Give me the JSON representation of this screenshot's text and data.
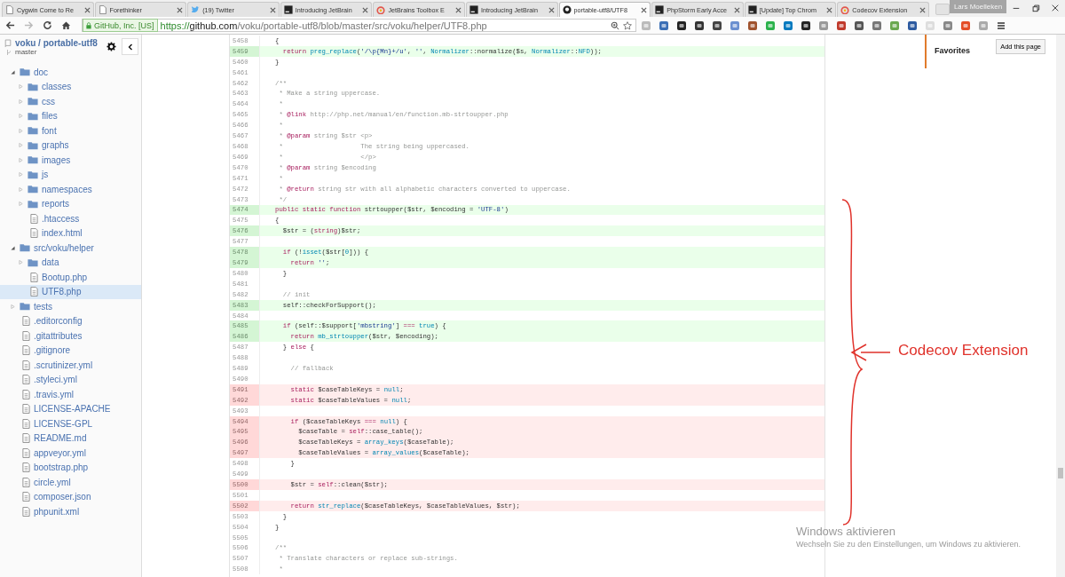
{
  "browser": {
    "tabs": [
      {
        "title": "Cygwin Come to Re",
        "selected": false
      },
      {
        "title": "Forethinker",
        "selected": false
      },
      {
        "title": "(19) Twitter",
        "selected": false
      },
      {
        "title": "Introducing JetBrain",
        "selected": false
      },
      {
        "title": "JetBrains Toolbox E",
        "selected": false
      },
      {
        "title": "Introducing JetBrain",
        "selected": false
      },
      {
        "title": "portable-utf8/UTF8",
        "selected": true
      },
      {
        "title": "PhpStorm Early Acce",
        "selected": false
      },
      {
        "title": "[Update] Top Chrom",
        "selected": false
      },
      {
        "title": "Codecov Extension",
        "selected": false
      }
    ],
    "user": "Lars Moelleken",
    "security_badge": "GitHub, Inc. [US]",
    "url": {
      "scheme": "https://",
      "host": "github.com",
      "path": "/voku/portable-utf8/blob/master/src/voku/helper/UTF8.php"
    }
  },
  "sidebar": {
    "repo": "voku / portable-utf8",
    "branch": "master",
    "tree": [
      {
        "label": "doc",
        "kind": "folder",
        "expanded": true,
        "selected": false,
        "children": [
          {
            "label": "classes",
            "kind": "folder",
            "expanded": false,
            "selected": false
          },
          {
            "label": "css",
            "kind": "folder",
            "expanded": false,
            "selected": false
          },
          {
            "label": "files",
            "kind": "folder",
            "expanded": false,
            "selected": false
          },
          {
            "label": "font",
            "kind": "folder",
            "expanded": false,
            "selected": false
          },
          {
            "label": "graphs",
            "kind": "folder",
            "expanded": false,
            "selected": false
          },
          {
            "label": "images",
            "kind": "folder",
            "expanded": false,
            "selected": false
          },
          {
            "label": "js",
            "kind": "folder",
            "expanded": false,
            "selected": false
          },
          {
            "label": "namespaces",
            "kind": "folder",
            "expanded": false,
            "selected": false
          },
          {
            "label": "reports",
            "kind": "folder",
            "expanded": false,
            "selected": false
          },
          {
            "label": ".htaccess",
            "kind": "file",
            "selected": false
          },
          {
            "label": "index.html",
            "kind": "file",
            "selected": false
          }
        ]
      },
      {
        "label": "src/voku/helper",
        "kind": "folder",
        "expanded": true,
        "selected": false,
        "children": [
          {
            "label": "data",
            "kind": "folder",
            "expanded": false,
            "selected": false
          },
          {
            "label": "Bootup.php",
            "kind": "file",
            "selected": false
          },
          {
            "label": "UTF8.php",
            "kind": "file",
            "selected": true
          }
        ]
      },
      {
        "label": "tests",
        "kind": "folder",
        "expanded": false,
        "selected": false
      },
      {
        "label": ".editorconfig",
        "kind": "file",
        "selected": false
      },
      {
        "label": ".gitattributes",
        "kind": "file",
        "selected": false
      },
      {
        "label": ".gitignore",
        "kind": "file",
        "selected": false
      },
      {
        "label": ".scrutinizer.yml",
        "kind": "file",
        "selected": false
      },
      {
        "label": ".styleci.yml",
        "kind": "file",
        "selected": false
      },
      {
        "label": ".travis.yml",
        "kind": "file",
        "selected": false
      },
      {
        "label": "LICENSE-APACHE",
        "kind": "file",
        "selected": false
      },
      {
        "label": "LICENSE-GPL",
        "kind": "file",
        "selected": false
      },
      {
        "label": "README.md",
        "kind": "file",
        "selected": false
      },
      {
        "label": "appveyor.yml",
        "kind": "file",
        "selected": false
      },
      {
        "label": "bootstrap.php",
        "kind": "file",
        "selected": false
      },
      {
        "label": "circle.yml",
        "kind": "file",
        "selected": false
      },
      {
        "label": "composer.json",
        "kind": "file",
        "selected": false
      },
      {
        "label": "phpunit.xml",
        "kind": "file",
        "selected": false
      }
    ]
  },
  "code": {
    "lines": [
      {
        "n": "5458",
        "kind": "plain",
        "tokens": [
          {
            "t": "{"
          }
        ]
      },
      {
        "n": "5459",
        "kind": "covered",
        "tokens": [
          {
            "kind": "kw",
            "t": "  return "
          },
          {
            "kind": "fn",
            "t": "preg_replace"
          },
          {
            "t": "("
          },
          {
            "kind": "str",
            "t": "'/\\p{Mn}+/u'"
          },
          {
            "t": ", "
          },
          {
            "kind": "str",
            "t": "''"
          },
          {
            "t": ", "
          },
          {
            "kind": "fn",
            "t": "Normalizer"
          },
          {
            "t": "::normalize($s, "
          },
          {
            "kind": "fn",
            "t": "Normalizer"
          },
          {
            "t": "::"
          },
          {
            "kind": "fn",
            "t": "NFD"
          },
          {
            "t": "));"
          }
        ]
      },
      {
        "n": "5460",
        "kind": "plain",
        "tokens": [
          {
            "t": "}"
          }
        ]
      },
      {
        "n": "5461",
        "kind": "plain"
      },
      {
        "n": "5462",
        "kind": "plain",
        "tokens": [
          {
            "kind": "cm",
            "t": "/**"
          }
        ]
      },
      {
        "n": "5463",
        "kind": "plain",
        "tokens": [
          {
            "kind": "cm",
            "t": " * Make a string uppercase."
          }
        ]
      },
      {
        "n": "5464",
        "kind": "plain",
        "tokens": [
          {
            "kind": "cm",
            "t": " *"
          }
        ]
      },
      {
        "n": "5465",
        "kind": "plain",
        "tokens": [
          {
            "kind": "cm",
            "t": " * "
          },
          {
            "kind": "kw",
            "t": "@link"
          },
          {
            "kind": "cm",
            "t": " http://php.net/manual/en/function.mb-strtoupper.php"
          }
        ]
      },
      {
        "n": "5466",
        "kind": "plain",
        "tokens": [
          {
            "kind": "cm",
            "t": " *"
          }
        ]
      },
      {
        "n": "5467",
        "kind": "plain",
        "tokens": [
          {
            "kind": "cm",
            "t": " * "
          },
          {
            "kind": "kw",
            "t": "@param"
          },
          {
            "kind": "cm",
            "t": " string $str <p>"
          }
        ]
      },
      {
        "n": "5468",
        "kind": "plain",
        "tokens": [
          {
            "kind": "cm",
            "t": " *                    The string being uppercased."
          }
        ]
      },
      {
        "n": "5469",
        "kind": "plain",
        "tokens": [
          {
            "kind": "cm",
            "t": " *                    </p>"
          }
        ]
      },
      {
        "n": "5470",
        "kind": "plain",
        "tokens": [
          {
            "kind": "cm",
            "t": " * "
          },
          {
            "kind": "kw",
            "t": "@param"
          },
          {
            "kind": "cm",
            "t": " string $encoding"
          }
        ]
      },
      {
        "n": "5471",
        "kind": "plain",
        "tokens": [
          {
            "kind": "cm",
            "t": " *"
          }
        ]
      },
      {
        "n": "5472",
        "kind": "plain",
        "tokens": [
          {
            "kind": "cm",
            "t": " * "
          },
          {
            "kind": "kw",
            "t": "@return"
          },
          {
            "kind": "cm",
            "t": " string str with all alphabetic characters converted to uppercase."
          }
        ]
      },
      {
        "n": "5473",
        "kind": "plain",
        "tokens": [
          {
            "kind": "cm",
            "t": " */"
          }
        ]
      },
      {
        "n": "5474",
        "kind": "covered",
        "tokens": [
          {
            "kind": "kw",
            "t": "public static function"
          },
          {
            "t": " strtoupper($str, $encoding = "
          },
          {
            "kind": "str",
            "t": "'UTF-8'"
          },
          {
            "t": ")"
          }
        ]
      },
      {
        "n": "5475",
        "kind": "plain",
        "tokens": [
          {
            "t": "{"
          }
        ]
      },
      {
        "n": "5476",
        "kind": "covered",
        "tokens": [
          {
            "t": "  $str = ("
          },
          {
            "kind": "kw",
            "t": "string"
          },
          {
            "t": ")$str;"
          }
        ]
      },
      {
        "n": "5477",
        "kind": "plain"
      },
      {
        "n": "5478",
        "kind": "covered",
        "tokens": [
          {
            "kind": "kw",
            "t": "  if"
          },
          {
            "t": " (!"
          },
          {
            "kind": "fn",
            "t": "isset"
          },
          {
            "t": "($str["
          },
          {
            "kind": "fn",
            "t": "0"
          },
          {
            "t": "])) {"
          }
        ]
      },
      {
        "n": "5479",
        "kind": "covered",
        "tokens": [
          {
            "kind": "kw",
            "t": "    return "
          },
          {
            "kind": "str",
            "t": "''"
          },
          {
            "t": ";"
          }
        ]
      },
      {
        "n": "5480",
        "kind": "plain",
        "tokens": [
          {
            "t": "  }"
          }
        ]
      },
      {
        "n": "5481",
        "kind": "plain"
      },
      {
        "n": "5482",
        "kind": "plain",
        "tokens": [
          {
            "kind": "cm",
            "t": "  // init"
          }
        ]
      },
      {
        "n": "5483",
        "kind": "covered",
        "tokens": [
          {
            "t": "  self::checkForSupport();"
          }
        ]
      },
      {
        "n": "5484",
        "kind": "plain"
      },
      {
        "n": "5485",
        "kind": "covered",
        "tokens": [
          {
            "kind": "kw",
            "t": "  if"
          },
          {
            "t": " (self::$support["
          },
          {
            "kind": "str",
            "t": "'mbstring'"
          },
          {
            "t": "] "
          },
          {
            "kind": "kw",
            "t": "=== "
          },
          {
            "kind": "fn",
            "t": "true"
          },
          {
            "t": ") {"
          }
        ]
      },
      {
        "n": "5486",
        "kind": "covered",
        "tokens": [
          {
            "kind": "kw",
            "t": "    return "
          },
          {
            "kind": "fn",
            "t": "mb_strtoupper"
          },
          {
            "t": "($str, $encoding);"
          }
        ]
      },
      {
        "n": "5487",
        "kind": "plain",
        "tokens": [
          {
            "t": "  } "
          },
          {
            "kind": "kw",
            "t": "else"
          },
          {
            "t": " {"
          }
        ]
      },
      {
        "n": "5488",
        "kind": "plain"
      },
      {
        "n": "5489",
        "kind": "plain",
        "tokens": [
          {
            "kind": "cm",
            "t": "    // fallback"
          }
        ]
      },
      {
        "n": "5490",
        "kind": "plain"
      },
      {
        "n": "5491",
        "kind": "missed",
        "tokens": [
          {
            "kind": "kw",
            "t": "    static"
          },
          {
            "t": " $caseTableKeys = "
          },
          {
            "kind": "fn",
            "t": "null"
          },
          {
            "t": ";"
          }
        ]
      },
      {
        "n": "5492",
        "kind": "missed",
        "tokens": [
          {
            "kind": "kw",
            "t": "    static"
          },
          {
            "t": " $caseTableValues = "
          },
          {
            "kind": "fn",
            "t": "null"
          },
          {
            "t": ";"
          }
        ]
      },
      {
        "n": "5493",
        "kind": "plain"
      },
      {
        "n": "5494",
        "kind": "missed",
        "tokens": [
          {
            "kind": "kw",
            "t": "    if"
          },
          {
            "t": " ($caseTableKeys "
          },
          {
            "kind": "kw",
            "t": "=== "
          },
          {
            "kind": "fn",
            "t": "null"
          },
          {
            "t": ") {"
          }
        ]
      },
      {
        "n": "5495",
        "kind": "missed",
        "tokens": [
          {
            "t": "      $caseTable = "
          },
          {
            "kind": "kw",
            "t": "self"
          },
          {
            "t": "::case_table();"
          }
        ]
      },
      {
        "n": "5496",
        "kind": "missed",
        "tokens": [
          {
            "t": "      $caseTableKeys = "
          },
          {
            "kind": "fn",
            "t": "array_keys"
          },
          {
            "t": "($caseTable);"
          }
        ]
      },
      {
        "n": "5497",
        "kind": "missed",
        "tokens": [
          {
            "t": "      $caseTableValues = "
          },
          {
            "kind": "fn",
            "t": "array_values"
          },
          {
            "t": "($caseTable);"
          }
        ]
      },
      {
        "n": "5498",
        "kind": "plain",
        "tokens": [
          {
            "t": "    }"
          }
        ]
      },
      {
        "n": "5499",
        "kind": "plain"
      },
      {
        "n": "5500",
        "kind": "missed",
        "tokens": [
          {
            "t": "    $str = "
          },
          {
            "kind": "kw",
            "t": "self"
          },
          {
            "t": "::clean($str);"
          }
        ]
      },
      {
        "n": "5501",
        "kind": "plain"
      },
      {
        "n": "5502",
        "kind": "missed",
        "tokens": [
          {
            "kind": "kw",
            "t": "    return "
          },
          {
            "kind": "fn",
            "t": "str_replace"
          },
          {
            "t": "($caseTableKeys, $caseTableValues, $str);"
          }
        ]
      },
      {
        "n": "5503",
        "kind": "plain",
        "tokens": [
          {
            "t": "  }"
          }
        ]
      },
      {
        "n": "5504",
        "kind": "plain",
        "tokens": [
          {
            "t": "}"
          }
        ]
      },
      {
        "n": "5505",
        "kind": "plain"
      },
      {
        "n": "5506",
        "kind": "plain",
        "tokens": [
          {
            "kind": "cm",
            "t": "/**"
          }
        ]
      },
      {
        "n": "5507",
        "kind": "plain",
        "tokens": [
          {
            "kind": "cm",
            "t": " * Translate characters or replace sub-strings."
          }
        ]
      },
      {
        "n": "5508",
        "kind": "plain",
        "tokens": [
          {
            "kind": "cm",
            "t": " *"
          }
        ]
      }
    ]
  },
  "favorites": {
    "title": "Favorites",
    "button": "Add this page"
  },
  "annotation": {
    "label": "Codecov Extension"
  },
  "os_notice": {
    "title": "Windows aktivieren",
    "text": "Wechseln Sie zu den Einstellungen, um Windows zu aktivieren."
  }
}
